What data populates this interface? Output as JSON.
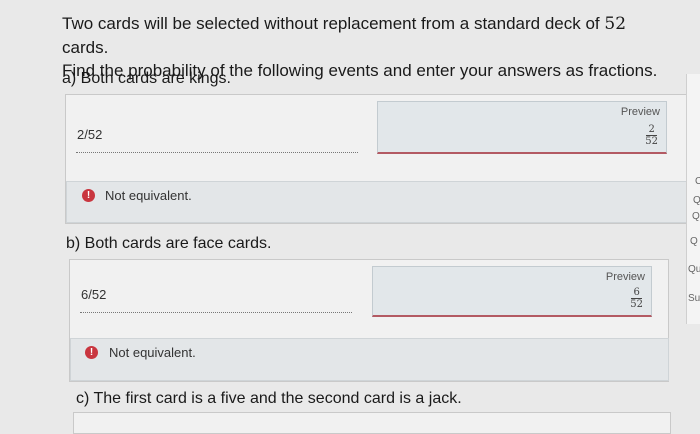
{
  "question": {
    "line1_pre": "Two cards will be selected without replacement from a standard deck of ",
    "line1_num": "52",
    "line1_post": " cards.",
    "line2": "Find the probability of the following events and enter your answers as fractions."
  },
  "parts": [
    {
      "label": "a) Both cards are kings.",
      "answer": "2/52",
      "preview_label": "Preview",
      "preview_num": "2",
      "preview_den": "52",
      "feedback": "Not equivalent."
    },
    {
      "label": "b) Both cards are face cards.",
      "answer": "6/52",
      "preview_label": "Preview",
      "preview_num": "6",
      "preview_den": "52",
      "feedback": "Not equivalent."
    },
    {
      "label": "c) The first card is a five and the second card is a jack."
    }
  ],
  "side_panel": {
    "c1": "C",
    "c2": "Q",
    "c3": "Q",
    "c4": "Q",
    "c5": "Qu",
    "c6": "Su"
  },
  "colors": {
    "error_icon": "#c9363f",
    "preview_underline": "#b35a63"
  },
  "icons": {
    "feedback": "alert-circle-icon"
  }
}
